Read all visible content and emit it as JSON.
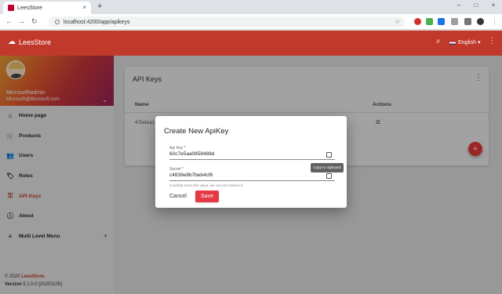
{
  "browser": {
    "tab_title": "LeesStore",
    "tab_close": "×",
    "new_tab": "+",
    "url": "localhost:4200/app/apikeys",
    "controls": {
      "minimize": "–",
      "maximize": "□",
      "close": "×"
    },
    "nav": {
      "back": "←",
      "forward": "→",
      "reload": "↻",
      "star": "☆"
    }
  },
  "toolbar": {
    "brand": "LeesStore",
    "brand_icon": "store-icon",
    "language": "English",
    "language_caret": "▾",
    "search_glyph": "⌕",
    "more_glyph": "⋮",
    "color": "#c0392b"
  },
  "sidebar": {
    "user_name": "Microsoft\\admin",
    "user_email": "Microsoft@Microsoft.com",
    "caret": "⌄",
    "items": [
      {
        "label": "Home page",
        "icon": "home-icon",
        "glyph": "⌂",
        "active": false
      },
      {
        "label": "Products",
        "icon": "cart-icon",
        "glyph": "🛒",
        "active": false
      },
      {
        "label": "Users",
        "icon": "users-icon",
        "glyph": "👥",
        "active": false
      },
      {
        "label": "Roles",
        "icon": "tag-icon",
        "glyph": "🏷",
        "active": false
      },
      {
        "label": "API Keys",
        "icon": "key-icon",
        "glyph": "⚿",
        "active": true
      },
      {
        "label": "About",
        "icon": "info-icon",
        "glyph": "ⓘ",
        "active": false
      },
      {
        "label": "Multi Level Menu",
        "icon": "menu-icon",
        "glyph": "≡",
        "active": false,
        "expand": "+"
      }
    ],
    "footer": {
      "copyright_prefix": "© 2020",
      "copyright_brand": "LeesStore.",
      "version_label": "Version",
      "version": "5.1.0.0 [20201105]"
    }
  },
  "main": {
    "card_title": "API Keys",
    "card_more": "⋮",
    "columns": {
      "name": "Name",
      "actions": "Actions"
    },
    "rows": [
      {
        "id": "47bdea1"
      }
    ],
    "row_menu": "≡",
    "fab": "+"
  },
  "dialog": {
    "title": "Create New ApiKey",
    "api_key_label": "Api Key *",
    "api_key_value": "60c7e5aa0858488d",
    "secret_label": "Secret *",
    "secret_value": "c4839e8b7beb4cf6",
    "hint": "Carefully store this value, we can not retrieve it",
    "cancel": "Cancel",
    "save": "Save",
    "tooltip": "Copy to clipboard",
    "accent": "#e53945"
  }
}
